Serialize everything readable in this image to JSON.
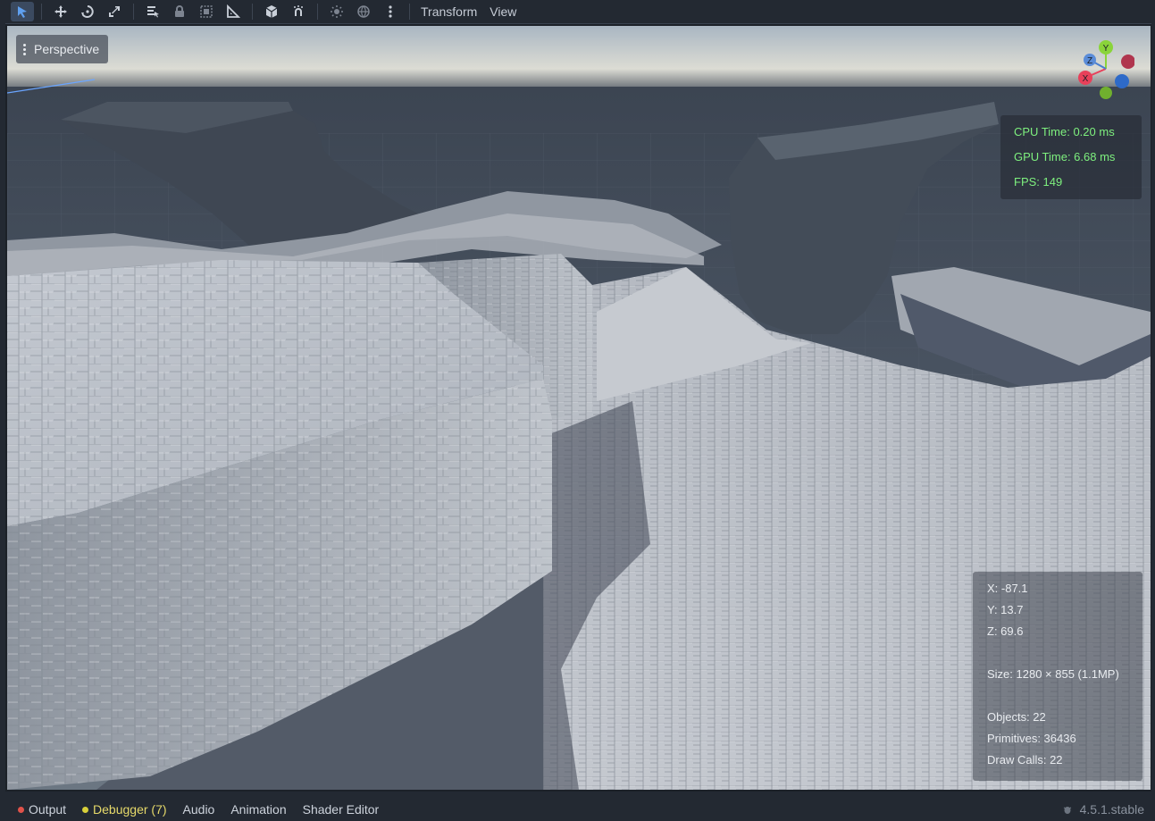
{
  "toolbar": {
    "tools": [
      {
        "name": "select-tool-icon",
        "active": true
      },
      {
        "name": "move-tool-icon"
      },
      {
        "name": "rotate-tool-icon"
      },
      {
        "name": "scale-tool-icon"
      },
      {
        "name": "list-select-icon"
      },
      {
        "name": "lock-icon"
      },
      {
        "name": "group-icon"
      },
      {
        "name": "ruler-icon"
      },
      {
        "name": "local-space-icon"
      },
      {
        "name": "snap-icon"
      },
      {
        "name": "sun-icon"
      },
      {
        "name": "environment-icon"
      },
      {
        "name": "more-icon"
      }
    ],
    "menus": {
      "transform": "Transform",
      "view": "View"
    }
  },
  "viewport": {
    "perspective_label": "Perspective",
    "gizmo": {
      "y": "Y",
      "z": "Z",
      "x": "X"
    },
    "stats": {
      "cpu_time": "CPU Time: 0.20 ms",
      "gpu_time": "GPU Time: 6.68 ms",
      "fps": "FPS: 149"
    },
    "info": {
      "x": "X: -87.1",
      "y": "Y: 13.7",
      "z": "Z: 69.6",
      "size": "Size: 1280 × 855 (1.1MP)",
      "objects": "Objects: 22",
      "primitives": "Primitives: 36436",
      "draw_calls": "Draw Calls: 22"
    }
  },
  "bottom_panel": {
    "tabs": [
      {
        "label": "Output",
        "dot": "#e0524a"
      },
      {
        "label": "Debugger (7)",
        "dot": "#d8cf3a",
        "color": "#e6d96a"
      },
      {
        "label": "Audio"
      },
      {
        "label": "Animation"
      },
      {
        "label": "Shader Editor"
      }
    ],
    "version": "4.5.1.stable"
  },
  "colors": {
    "accent": "#4a8ee8",
    "stats_text": "#7ef07e"
  }
}
